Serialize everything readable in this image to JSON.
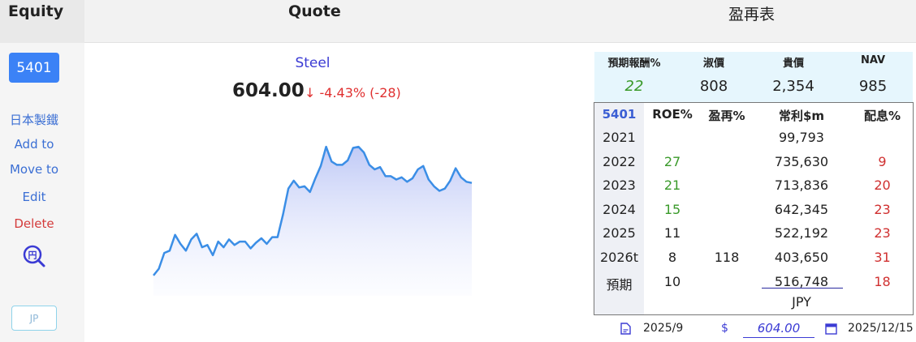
{
  "header": {
    "equity_label": "Equity",
    "quote_label": "Quote",
    "pe_table_label": "盈再表"
  },
  "sidebar": {
    "ticker": "5401",
    "company_name": "日本製鐵",
    "add_to": "Add to",
    "move_to": "Move to",
    "edit": "Edit",
    "delete": "Delete",
    "search_icon_glyph": "円",
    "market_button": "JP"
  },
  "quote": {
    "name": "Steel",
    "price": "604.00",
    "change": "↓ -4.43% (-28)"
  },
  "chart_data": {
    "type": "area",
    "values": [
      318,
      324,
      338,
      340,
      354,
      346,
      340,
      350,
      355,
      343,
      345,
      336,
      348,
      343,
      350,
      345,
      348,
      348,
      342,
      347,
      351,
      346,
      352,
      352,
      372,
      395,
      402,
      396,
      397,
      392,
      404,
      415,
      432,
      419,
      416,
      416,
      420,
      431,
      432,
      427,
      416,
      412,
      414,
      406,
      406,
      403,
      405,
      401,
      404,
      412,
      415,
      403,
      397,
      393,
      395,
      402,
      413,
      405,
      401,
      400
    ],
    "color": "#3b8ee6"
  },
  "stats": {
    "labels": [
      "預期報酬%",
      "淑價",
      "貴價",
      "NAV"
    ],
    "values": [
      "22",
      "808",
      "2,354",
      "985"
    ]
  },
  "table": {
    "headers": [
      "5401",
      "ROE%",
      "盈再%",
      "常利$m",
      "配息%"
    ],
    "rows": [
      [
        "2021",
        "",
        "",
        "99,793",
        ""
      ],
      [
        "2022",
        "27",
        "",
        "735,630",
        "9"
      ],
      [
        "2023",
        "21",
        "",
        "713,836",
        "20"
      ],
      [
        "2024",
        "15",
        "",
        "642,345",
        "23"
      ],
      [
        "2025",
        "11",
        "",
        "522,192",
        "23"
      ],
      [
        "2026t",
        "8",
        "118",
        "403,650",
        "31"
      ],
      [
        "預期",
        "10",
        "",
        "516,748",
        "18"
      ]
    ],
    "currency": "JPY"
  },
  "footer": {
    "report_date": "2025/9",
    "dollar_sign": "$",
    "price_input": "604.00",
    "quote_date": "2025/12/15"
  }
}
